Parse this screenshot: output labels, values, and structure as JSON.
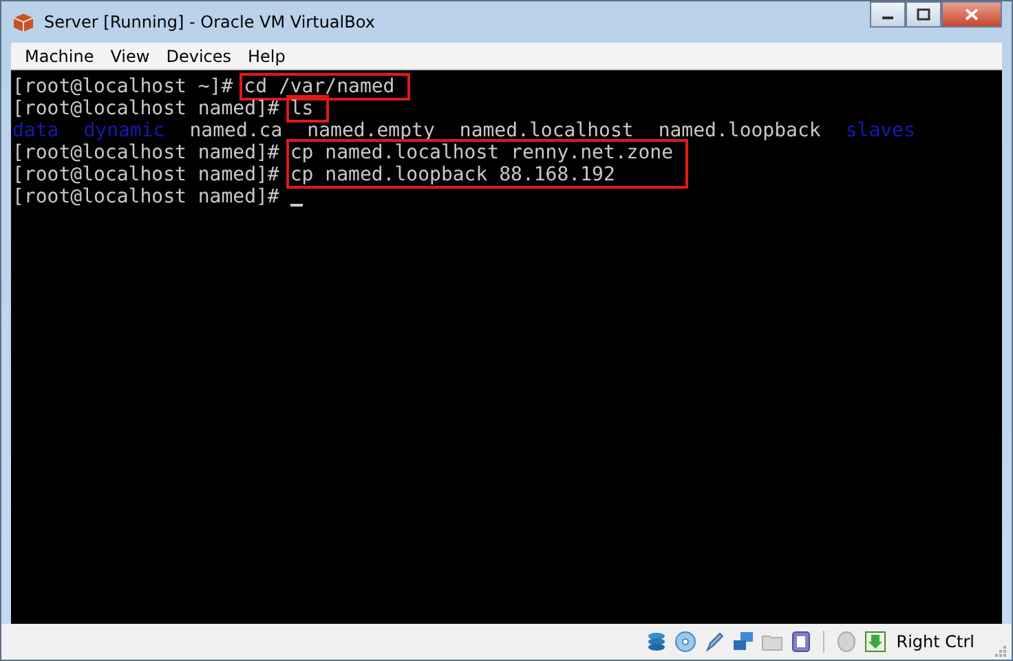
{
  "window": {
    "title": "Server [Running] - Oracle VM VirtualBox"
  },
  "menu": [
    "Machine",
    "View",
    "Devices",
    "Help"
  ],
  "terminal": [
    {
      "kind": "commands",
      "highlighted": true,
      "entries": [
        {
          "prompt": "[root@localhost ~]#",
          "command": "cd /var/named"
        }
      ]
    },
    {
      "kind": "commands",
      "highlighted": true,
      "entries": [
        {
          "prompt": "[root@localhost named]#",
          "command": "ls"
        }
      ]
    },
    {
      "kind": "listing",
      "items": [
        {
          "name": "data",
          "directory": true
        },
        {
          "name": "dynamic",
          "directory": true
        },
        {
          "name": "named.ca",
          "directory": false
        },
        {
          "name": "named.empty",
          "directory": false
        },
        {
          "name": "named.localhost",
          "directory": false
        },
        {
          "name": "named.loopback",
          "directory": false
        },
        {
          "name": "slaves",
          "directory": true
        }
      ]
    },
    {
      "kind": "commands",
      "highlighted": true,
      "entries": [
        {
          "prompt": "[root@localhost named]#",
          "command": "cp named.localhost renny.net.zone"
        },
        {
          "prompt": "[root@localhost named]#",
          "command": "cp named.loopback 88.168.192"
        }
      ]
    },
    {
      "kind": "prompt",
      "prompt": "[root@localhost named]#",
      "cursor": true
    }
  ],
  "status_bar": {
    "host_key": "Right Ctrl"
  }
}
